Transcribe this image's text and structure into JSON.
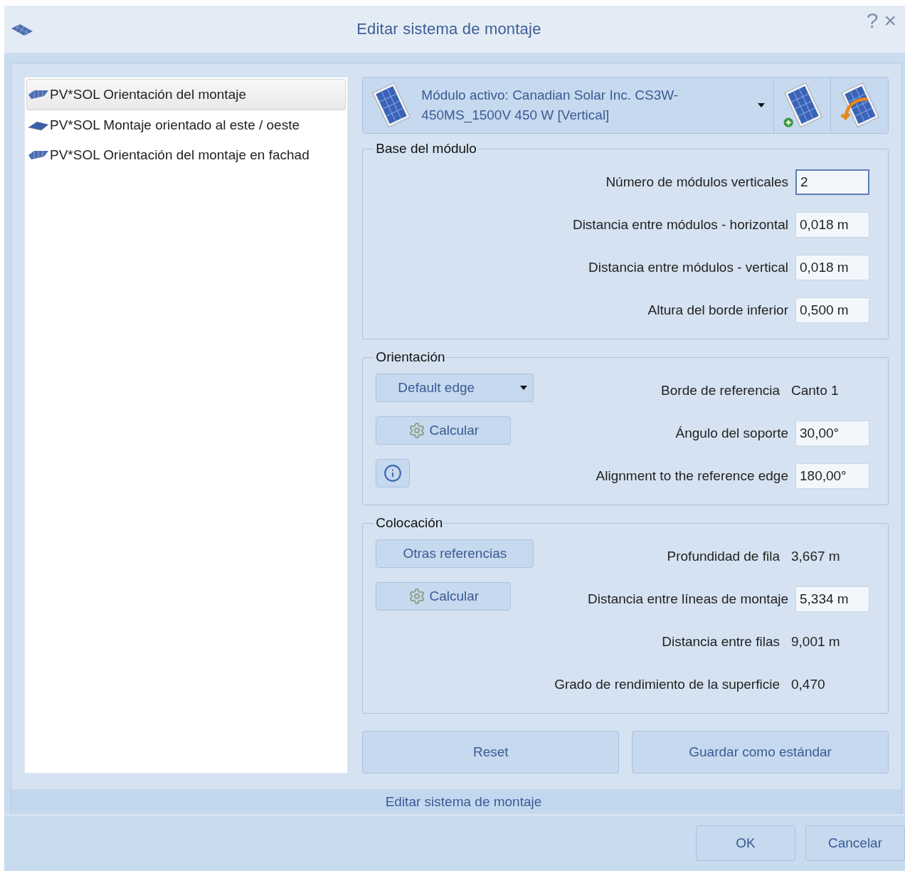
{
  "window": {
    "title": "Editar sistema de montaje",
    "help": "?",
    "close": "×"
  },
  "systems": [
    {
      "label": "PV*SOL Orientación del montaje",
      "kind": "rack",
      "selected": true
    },
    {
      "label": "PV*SOL Montaje orientado al este / oeste",
      "kind": "eastwest",
      "selected": false
    },
    {
      "label": "PV*SOL Orientación del montaje en fachad",
      "kind": "rack",
      "selected": false
    }
  ],
  "module": {
    "label": "Módulo activo: Canadian Solar Inc. CS3W-450MS_1500V 450 W [Vertical]"
  },
  "sections": [
    {
      "title": "Base del módulo",
      "rows": [
        {
          "label": "Número de módulos verticales",
          "value": "2",
          "kind": "field",
          "focused": true
        },
        {
          "label": "Distancia entre módulos - horizontal",
          "value": "0,018 m",
          "kind": "field",
          "focused": false
        },
        {
          "label": "Distancia entre módulos - vertical",
          "value": "0,018 m",
          "kind": "field",
          "focused": false
        },
        {
          "label": "Altura del borde inferior",
          "value": "0,500 m",
          "kind": "field",
          "focused": false
        }
      ]
    },
    {
      "title": "Orientación",
      "controls": [
        {
          "kind": "dropdown",
          "label": "Default edge"
        },
        {
          "kind": "calc",
          "label": "Calcular"
        },
        {
          "kind": "info"
        }
      ],
      "rows": [
        {
          "label": "Borde de referencia",
          "value": "Canto 1",
          "kind": "text"
        },
        {
          "label": "Ángulo del soporte",
          "value": "30,00°",
          "kind": "field",
          "focused": false
        },
        {
          "label": "Alignment to the reference edge",
          "value": "180,00°",
          "kind": "field",
          "focused": false
        }
      ]
    },
    {
      "title": "Colocación",
      "controls": [
        {
          "kind": "button",
          "label": "Otras referencias"
        },
        {
          "kind": "calc",
          "label": "Calcular"
        }
      ],
      "rows": [
        {
          "label": "Profundidad de fila",
          "value": "3,667 m",
          "kind": "text"
        },
        {
          "label": "Distancia entre líneas de montaje",
          "value": "5,334 m",
          "kind": "field",
          "focused": false
        },
        {
          "label": "Distancia entre filas",
          "value": "9,001 m",
          "kind": "text"
        },
        {
          "label": "Grado de rendimiento de la superficie",
          "value": "0,470",
          "kind": "text"
        }
      ]
    }
  ],
  "actions": [
    "Reset",
    "Guardar como estándar"
  ],
  "status_bar": "Editar sistema de montaje",
  "buttons": [
    "OK",
    "Cancelar"
  ]
}
